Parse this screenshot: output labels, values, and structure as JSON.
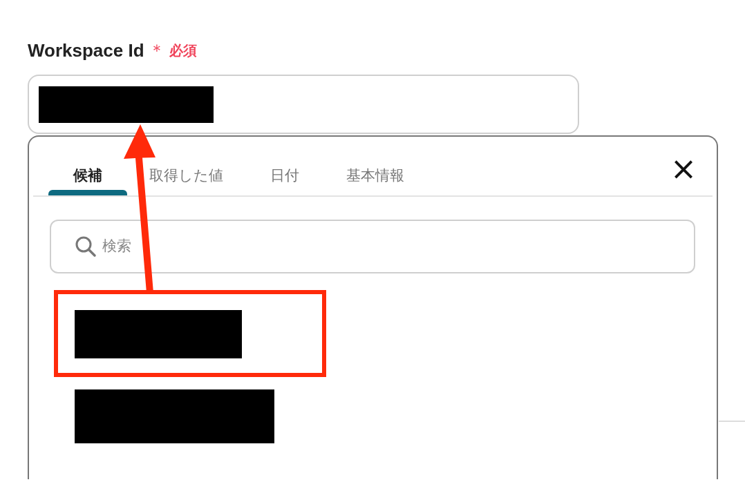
{
  "field": {
    "label": "Workspace Id",
    "required_mark": "＊",
    "required_text": "必須"
  },
  "picker": {
    "tabs": [
      {
        "label": "候補",
        "selected": true
      },
      {
        "label": "取得した値",
        "selected": false
      },
      {
        "label": "日付",
        "selected": false
      },
      {
        "label": "基本情報",
        "selected": false
      }
    ],
    "close": "×",
    "search": {
      "placeholder": "検索"
    },
    "candidates": [
      {
        "kind": "redacted",
        "highlighted": true
      },
      {
        "kind": "redacted",
        "highlighted": false
      }
    ]
  }
}
